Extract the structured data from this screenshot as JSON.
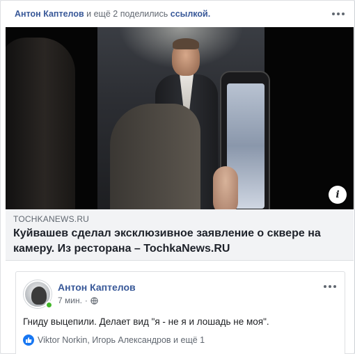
{
  "share_header": {
    "actor": "Антон Каптелов",
    "and_others": "и ещё 2",
    "action": "поделились",
    "object": "ссылкой."
  },
  "link_preview": {
    "domain": "TOCHKANEWS.RU",
    "title": "Куйвашев сделал эксклюзивное заявление о сквере на камеру. Из ресторана – TochkaNews.RU"
  },
  "info_badge": "i",
  "embedded_post": {
    "author": "Антон Каптелов",
    "time": "7 мин.",
    "separator": "·",
    "text": "Гниду выцепили. Делает вид \"я - не я и лошадь не моя\".",
    "reactions": "Viktor Norkin, Игорь Александров и ещё 1"
  },
  "icons": {
    "more": "more-horizontal-icon",
    "info": "info-icon",
    "privacy": "globe-icon",
    "reaction": "like-icon"
  },
  "colors": {
    "link_blue": "#385898",
    "muted": "#606770",
    "online": "#42b72a",
    "like": "#1877f2"
  }
}
